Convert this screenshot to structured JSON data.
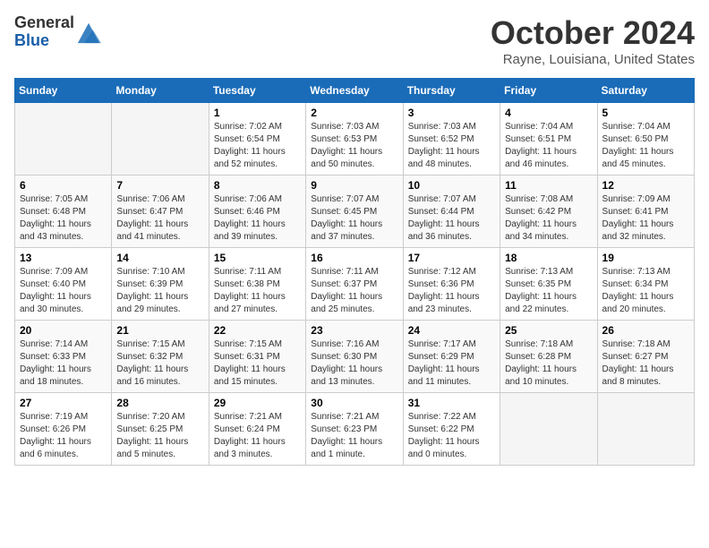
{
  "logo": {
    "general": "General",
    "blue": "Blue"
  },
  "title": "October 2024",
  "location": "Rayne, Louisiana, United States",
  "days_of_week": [
    "Sunday",
    "Monday",
    "Tuesday",
    "Wednesday",
    "Thursday",
    "Friday",
    "Saturday"
  ],
  "weeks": [
    [
      {
        "day": "",
        "sunrise": "",
        "sunset": "",
        "daylight": ""
      },
      {
        "day": "",
        "sunrise": "",
        "sunset": "",
        "daylight": ""
      },
      {
        "day": "1",
        "sunrise": "Sunrise: 7:02 AM",
        "sunset": "Sunset: 6:54 PM",
        "daylight": "Daylight: 11 hours and 52 minutes."
      },
      {
        "day": "2",
        "sunrise": "Sunrise: 7:03 AM",
        "sunset": "Sunset: 6:53 PM",
        "daylight": "Daylight: 11 hours and 50 minutes."
      },
      {
        "day": "3",
        "sunrise": "Sunrise: 7:03 AM",
        "sunset": "Sunset: 6:52 PM",
        "daylight": "Daylight: 11 hours and 48 minutes."
      },
      {
        "day": "4",
        "sunrise": "Sunrise: 7:04 AM",
        "sunset": "Sunset: 6:51 PM",
        "daylight": "Daylight: 11 hours and 46 minutes."
      },
      {
        "day": "5",
        "sunrise": "Sunrise: 7:04 AM",
        "sunset": "Sunset: 6:50 PM",
        "daylight": "Daylight: 11 hours and 45 minutes."
      }
    ],
    [
      {
        "day": "6",
        "sunrise": "Sunrise: 7:05 AM",
        "sunset": "Sunset: 6:48 PM",
        "daylight": "Daylight: 11 hours and 43 minutes."
      },
      {
        "day": "7",
        "sunrise": "Sunrise: 7:06 AM",
        "sunset": "Sunset: 6:47 PM",
        "daylight": "Daylight: 11 hours and 41 minutes."
      },
      {
        "day": "8",
        "sunrise": "Sunrise: 7:06 AM",
        "sunset": "Sunset: 6:46 PM",
        "daylight": "Daylight: 11 hours and 39 minutes."
      },
      {
        "day": "9",
        "sunrise": "Sunrise: 7:07 AM",
        "sunset": "Sunset: 6:45 PM",
        "daylight": "Daylight: 11 hours and 37 minutes."
      },
      {
        "day": "10",
        "sunrise": "Sunrise: 7:07 AM",
        "sunset": "Sunset: 6:44 PM",
        "daylight": "Daylight: 11 hours and 36 minutes."
      },
      {
        "day": "11",
        "sunrise": "Sunrise: 7:08 AM",
        "sunset": "Sunset: 6:42 PM",
        "daylight": "Daylight: 11 hours and 34 minutes."
      },
      {
        "day": "12",
        "sunrise": "Sunrise: 7:09 AM",
        "sunset": "Sunset: 6:41 PM",
        "daylight": "Daylight: 11 hours and 32 minutes."
      }
    ],
    [
      {
        "day": "13",
        "sunrise": "Sunrise: 7:09 AM",
        "sunset": "Sunset: 6:40 PM",
        "daylight": "Daylight: 11 hours and 30 minutes."
      },
      {
        "day": "14",
        "sunrise": "Sunrise: 7:10 AM",
        "sunset": "Sunset: 6:39 PM",
        "daylight": "Daylight: 11 hours and 29 minutes."
      },
      {
        "day": "15",
        "sunrise": "Sunrise: 7:11 AM",
        "sunset": "Sunset: 6:38 PM",
        "daylight": "Daylight: 11 hours and 27 minutes."
      },
      {
        "day": "16",
        "sunrise": "Sunrise: 7:11 AM",
        "sunset": "Sunset: 6:37 PM",
        "daylight": "Daylight: 11 hours and 25 minutes."
      },
      {
        "day": "17",
        "sunrise": "Sunrise: 7:12 AM",
        "sunset": "Sunset: 6:36 PM",
        "daylight": "Daylight: 11 hours and 23 minutes."
      },
      {
        "day": "18",
        "sunrise": "Sunrise: 7:13 AM",
        "sunset": "Sunset: 6:35 PM",
        "daylight": "Daylight: 11 hours and 22 minutes."
      },
      {
        "day": "19",
        "sunrise": "Sunrise: 7:13 AM",
        "sunset": "Sunset: 6:34 PM",
        "daylight": "Daylight: 11 hours and 20 minutes."
      }
    ],
    [
      {
        "day": "20",
        "sunrise": "Sunrise: 7:14 AM",
        "sunset": "Sunset: 6:33 PM",
        "daylight": "Daylight: 11 hours and 18 minutes."
      },
      {
        "day": "21",
        "sunrise": "Sunrise: 7:15 AM",
        "sunset": "Sunset: 6:32 PM",
        "daylight": "Daylight: 11 hours and 16 minutes."
      },
      {
        "day": "22",
        "sunrise": "Sunrise: 7:15 AM",
        "sunset": "Sunset: 6:31 PM",
        "daylight": "Daylight: 11 hours and 15 minutes."
      },
      {
        "day": "23",
        "sunrise": "Sunrise: 7:16 AM",
        "sunset": "Sunset: 6:30 PM",
        "daylight": "Daylight: 11 hours and 13 minutes."
      },
      {
        "day": "24",
        "sunrise": "Sunrise: 7:17 AM",
        "sunset": "Sunset: 6:29 PM",
        "daylight": "Daylight: 11 hours and 11 minutes."
      },
      {
        "day": "25",
        "sunrise": "Sunrise: 7:18 AM",
        "sunset": "Sunset: 6:28 PM",
        "daylight": "Daylight: 11 hours and 10 minutes."
      },
      {
        "day": "26",
        "sunrise": "Sunrise: 7:18 AM",
        "sunset": "Sunset: 6:27 PM",
        "daylight": "Daylight: 11 hours and 8 minutes."
      }
    ],
    [
      {
        "day": "27",
        "sunrise": "Sunrise: 7:19 AM",
        "sunset": "Sunset: 6:26 PM",
        "daylight": "Daylight: 11 hours and 6 minutes."
      },
      {
        "day": "28",
        "sunrise": "Sunrise: 7:20 AM",
        "sunset": "Sunset: 6:25 PM",
        "daylight": "Daylight: 11 hours and 5 minutes."
      },
      {
        "day": "29",
        "sunrise": "Sunrise: 7:21 AM",
        "sunset": "Sunset: 6:24 PM",
        "daylight": "Daylight: 11 hours and 3 minutes."
      },
      {
        "day": "30",
        "sunrise": "Sunrise: 7:21 AM",
        "sunset": "Sunset: 6:23 PM",
        "daylight": "Daylight: 11 hours and 1 minute."
      },
      {
        "day": "31",
        "sunrise": "Sunrise: 7:22 AM",
        "sunset": "Sunset: 6:22 PM",
        "daylight": "Daylight: 11 hours and 0 minutes."
      },
      {
        "day": "",
        "sunrise": "",
        "sunset": "",
        "daylight": ""
      },
      {
        "day": "",
        "sunrise": "",
        "sunset": "",
        "daylight": ""
      }
    ]
  ]
}
